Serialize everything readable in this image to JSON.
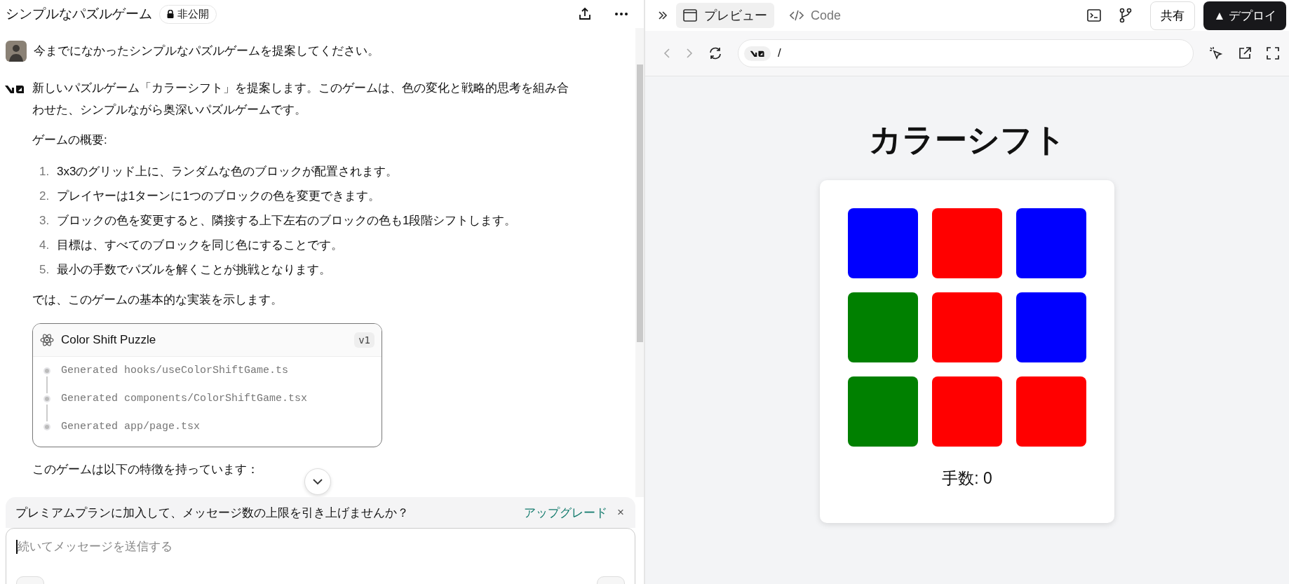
{
  "chat": {
    "title": "シンプルなパズルゲーム",
    "visibility": "非公開",
    "user_message": "今までになかったシンプルなパズルゲームを提案してください。",
    "assistant": {
      "intro": "新しいパズルゲーム「カラーシフト」を提案します。このゲームは、色の変化と戦略的思考を組み合わせた、シンプルながら奥深いパズルゲームです。",
      "heading": "ゲームの概要:",
      "rules": [
        {
          "number": "1.",
          "text": "3x3のグリッド上に、ランダムな色のブロックが配置されます。"
        },
        {
          "number": "2.",
          "text": "プレイヤーは1ターンに1つのブロックの色を変更できます。"
        },
        {
          "number": "3.",
          "text": "ブロックの色を変更すると、隣接する上下左右のブロックの色も1段階シフトします。"
        },
        {
          "number": "4.",
          "text": "目標は、すべてのブロックを同じ色にすることです。"
        },
        {
          "number": "5.",
          "text": "最小の手数でパズルを解くことが挑戦となります。"
        }
      ],
      "outro": "では、このゲームの基本的な実装を示します。",
      "artifact": {
        "title": "Color Shift Puzzle",
        "version": "v1",
        "steps": [
          "Generated hooks/useColorShiftGame.ts",
          "Generated components/ColorShiftGame.tsx",
          "Generated app/page.tsx"
        ]
      },
      "after": "このゲームは以下の特徴を持っています："
    },
    "banner": {
      "text": "プレミアムプランに加入して、メッセージ数の上限を引き上げませんか？",
      "link": "アップグレード",
      "close": "×"
    },
    "composer": {
      "placeholder": "続いてメッセージを送信する"
    }
  },
  "preview": {
    "tabs": [
      {
        "label": "プレビュー",
        "selected": true
      },
      {
        "label": "Code",
        "selected": false
      }
    ],
    "share_button": "共有",
    "deploy_button": "▲ デプロイ",
    "address": "/",
    "game": {
      "title": "カラーシフト",
      "blocks": [
        {
          "color": "#0000ff"
        },
        {
          "color": "#ff0000"
        },
        {
          "color": "#0000ff"
        },
        {
          "color": "#008000"
        },
        {
          "color": "#ff0000"
        },
        {
          "color": "#0000ff"
        },
        {
          "color": "#008000"
        },
        {
          "color": "#ff0000"
        },
        {
          "color": "#ff0000"
        }
      ],
      "moves": "手数: 0"
    }
  }
}
